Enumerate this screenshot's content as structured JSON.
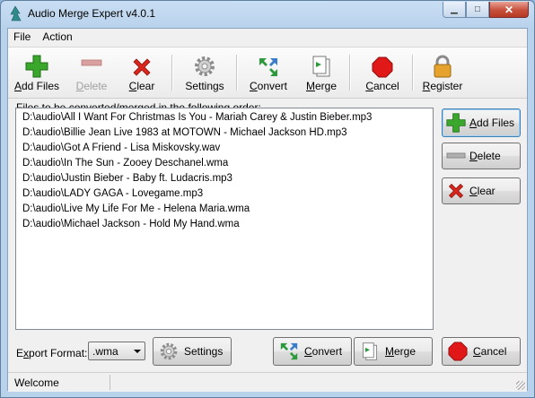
{
  "window": {
    "title": "Audio Merge Expert v4.0.1"
  },
  "menu": [
    {
      "label": "File"
    },
    {
      "label": "Action"
    }
  ],
  "toolbar": {
    "add_files": {
      "first": "A",
      "rest": "dd Files"
    },
    "delete": {
      "first": "D",
      "rest": "elete"
    },
    "clear": {
      "first": "C",
      "rest": "lear"
    },
    "settings": "Settings",
    "convert": {
      "first": "C",
      "rest": "onvert"
    },
    "merge": {
      "first": "M",
      "rest": "erge"
    },
    "cancel": {
      "first": "C",
      "rest": "ancel"
    },
    "register": {
      "first": "R",
      "rest": "egister"
    }
  },
  "list": {
    "caption": "Files to be converted/merged in the following order:",
    "files": [
      "D:\\audio\\All I Want For Christmas Is You - Mariah Carey & Justin Bieber.mp3",
      "D:\\audio\\Billie Jean Live 1983 at MOTOWN - Michael Jackson HD.mp3",
      "D:\\audio\\Got A Friend - Lisa Miskovsky.wav",
      "D:\\audio\\In The Sun - Zooey Deschanel.wma",
      "D:\\audio\\Justin Bieber - Baby ft. Ludacris.mp3",
      "D:\\audio\\LADY GAGA - Lovegame.mp3",
      "D:\\audio\\Live My Life For Me - Helena Maria.wma",
      "D:\\audio\\Michael Jackson - Hold My Hand.wma"
    ]
  },
  "side": {
    "add_files": {
      "first": "A",
      "rest": "dd Files"
    },
    "delete": {
      "first": "D",
      "rest": "elete"
    },
    "clear": {
      "first": "C",
      "rest": "lear"
    }
  },
  "bottom": {
    "export_label": {
      "pre": "E",
      "u": "x",
      "post": "port Format:"
    },
    "format_value": ".wma",
    "settings": "Settings",
    "convert": {
      "first": "C",
      "rest": "onvert"
    },
    "merge": {
      "first": "M",
      "rest": "erge"
    },
    "cancel": {
      "first": "C",
      "rest": "ancel"
    }
  },
  "status": {
    "text": "Welcome"
  },
  "colors": {
    "add": "#3aa62c",
    "clear": "#d9261c",
    "cancel": "#e01818",
    "convert": "#2c9a3c"
  }
}
